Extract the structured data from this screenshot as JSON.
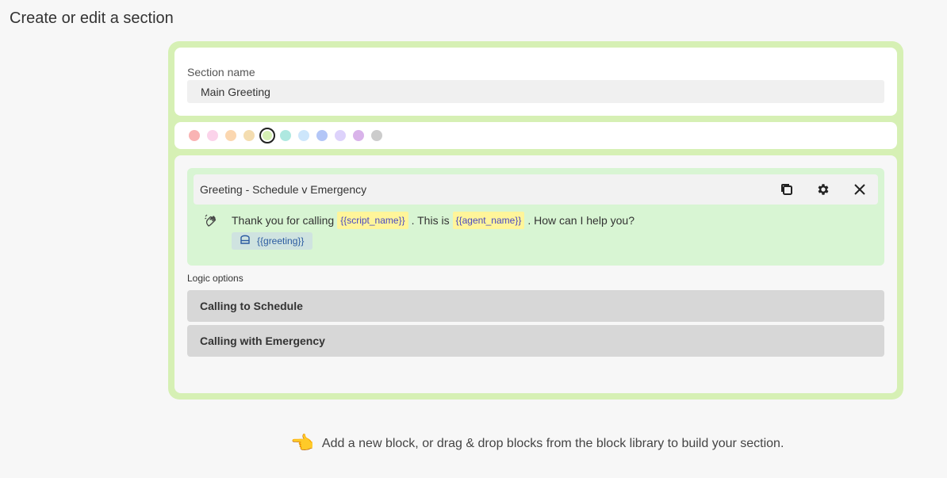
{
  "page": {
    "title": "Create or edit a section"
  },
  "section_form": {
    "name_label": "Section name",
    "name_value": "Main Greeting"
  },
  "color_picker": {
    "swatches": [
      "#f9b3b3",
      "#fbd3ea",
      "#fbd7b0",
      "#f4ddb0",
      "#d6f0b4",
      "#aee8e0",
      "#cde6fb",
      "#b3c6f7",
      "#ddd2fb",
      "#d9b3ea",
      "#cccccc"
    ],
    "selected_index": 4
  },
  "block": {
    "title": "Greeting - Schedule v Emergency",
    "script": {
      "part1": "Thank you for calling",
      "var1": "{{script_name}}",
      "part2": ". This is",
      "var2": "{{agent_name}}",
      "part3": ". How can I help you?"
    },
    "variable_chip": "{{greeting}}",
    "icons": {
      "duplicate": "copy-icon",
      "settings": "gear-icon",
      "close": "close-icon",
      "speaker": "hand-wave-icon",
      "variable": "database-icon"
    }
  },
  "logic": {
    "title": "Logic options",
    "options": [
      {
        "label": "Calling to Schedule"
      },
      {
        "label": "Calling with Emergency"
      }
    ]
  },
  "hint": {
    "icon": "👈",
    "text": "Add a new block, or drag & drop blocks from the block library to build your section."
  }
}
